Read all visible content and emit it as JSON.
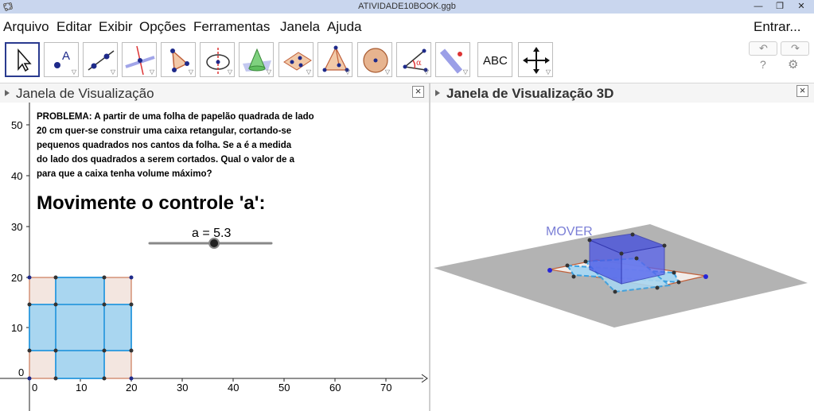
{
  "window": {
    "title": "ATIVIDADE10BOOK.ggb",
    "minimize": "—",
    "maximize": "❐",
    "close": "✕"
  },
  "menu": {
    "items": [
      "Arquivo",
      "Editar",
      "Exibir",
      "Opções",
      "Ferramentas",
      "Janela",
      "Ajuda"
    ],
    "signin": "Entrar..."
  },
  "toolbar": {
    "tools": [
      {
        "name": "move-tool-icon"
      },
      {
        "name": "point-tool-icon",
        "text": "A"
      },
      {
        "name": "line-tool-icon"
      },
      {
        "name": "perpendicular-line-tool-icon"
      },
      {
        "name": "polygon-tool-icon"
      },
      {
        "name": "circle-axis-tool-icon"
      },
      {
        "name": "cone-tool-icon"
      },
      {
        "name": "plane-points-tool-icon"
      },
      {
        "name": "pyramid-tool-icon"
      },
      {
        "name": "sphere-tool-icon"
      },
      {
        "name": "angle-tool-icon",
        "text": "α"
      },
      {
        "name": "reflect-tool-icon"
      },
      {
        "name": "text-tool-icon",
        "text": "ABC"
      },
      {
        "name": "move-graphics-view-tool-icon"
      }
    ],
    "undo": "↶",
    "redo": "↷",
    "help": "?",
    "settings": "⚙"
  },
  "graphics_view": {
    "title": "Janela de Visualização",
    "problem_lines": [
      "PROBLEMA: A partir de uma folha de papelão quadrada de lado",
      "20 cm quer-se construir uma caixa retangular,  cortando-se",
      " pequenos quadrados nos cantos da folha. Se a é a medida",
      "do lado dos quadrados a serem cortados. Qual o valor de a",
      "para que a caixa tenha volume máximo?"
    ],
    "headline": "Movimente o controle 'a':",
    "slider": {
      "label": "a = 5.3",
      "value": 5.3,
      "min": 0,
      "max": 10
    },
    "x_ticks": [
      "0",
      "10",
      "20",
      "30",
      "40",
      "50",
      "60",
      "70"
    ],
    "y_ticks": [
      "0",
      "10",
      "20",
      "30",
      "40",
      "50"
    ]
  },
  "view3d": {
    "title": "Janela de Visualização 3D",
    "mover_label": "MOVER"
  },
  "colors": {
    "accent": "#2a3b8f",
    "sheet": "#f3e6e0",
    "sheet_border": "#c0603a",
    "cut": "#a9d6f0",
    "cut_border": "#3aa0e0",
    "box": "#3f4ae0",
    "plane": "#b3b3b3"
  }
}
